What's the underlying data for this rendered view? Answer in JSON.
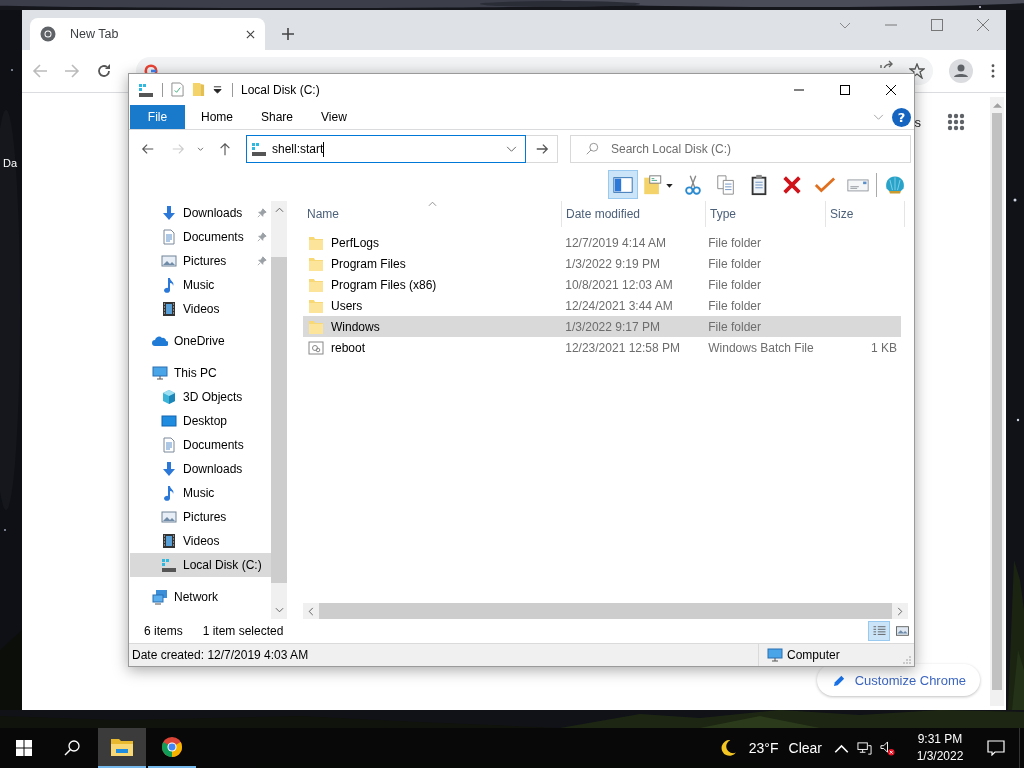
{
  "desktop": {
    "icon_label": "Da"
  },
  "browser": {
    "tab": {
      "title": "New Tab"
    },
    "link_fragment": "s",
    "customize_button": "Customize Chrome"
  },
  "explorer": {
    "title": "Local Disk (C:)",
    "ribbon_tabs": [
      {
        "label": "File",
        "kind": "file"
      },
      {
        "label": "Home",
        "kind": "tab"
      },
      {
        "label": "Share",
        "kind": "tab"
      },
      {
        "label": "View",
        "kind": "tab"
      }
    ],
    "address": {
      "value": "shell:start"
    },
    "search": {
      "placeholder": "Search Local Disk (C:)"
    },
    "help_button": "?",
    "toolbar": [
      {
        "kind": "panes",
        "on": true
      },
      {
        "kind": "new-folder",
        "on": false
      },
      {
        "kind": "cut",
        "on": false
      },
      {
        "kind": "copy",
        "on": false
      },
      {
        "kind": "paste",
        "on": false
      },
      {
        "kind": "delete",
        "on": false
      },
      {
        "kind": "check",
        "on": false
      },
      {
        "kind": "mail",
        "on": false
      },
      {
        "kind": "shell",
        "on": false
      }
    ],
    "nav_pane": [
      {
        "children": [
          {
            "label": "Downloads",
            "kind": "download",
            "pinned": true,
            "selected": false
          },
          {
            "label": "Documents",
            "kind": "document",
            "pinned": true,
            "selected": false
          },
          {
            "label": "Pictures",
            "kind": "picture",
            "pinned": true,
            "selected": false
          },
          {
            "label": "Music",
            "kind": "music",
            "pinned": false,
            "selected": false
          },
          {
            "label": "Videos",
            "kind": "video",
            "pinned": false,
            "selected": false
          }
        ]
      },
      {
        "label": "OneDrive",
        "kind": "cloud",
        "selected": false
      },
      {
        "label": "This PC",
        "kind": "pc",
        "selected": false,
        "children": [
          {
            "label": "3D Objects",
            "kind": "cube",
            "selected": false
          },
          {
            "label": "Desktop",
            "kind": "desktop",
            "selected": false
          },
          {
            "label": "Documents",
            "kind": "document",
            "selected": false
          },
          {
            "label": "Downloads",
            "kind": "download",
            "selected": false
          },
          {
            "label": "Music",
            "kind": "music",
            "selected": false
          },
          {
            "label": "Pictures",
            "kind": "picture",
            "selected": false
          },
          {
            "label": "Videos",
            "kind": "video",
            "selected": false
          },
          {
            "label": "Local Disk (C:)",
            "kind": "drive",
            "selected": true
          }
        ]
      },
      {
        "label": "Network",
        "kind": "network",
        "selected": false
      }
    ],
    "columns": [
      {
        "label": "Name",
        "sorted": true
      },
      {
        "label": "Date modified",
        "sorted": false
      },
      {
        "label": "Type",
        "sorted": false
      },
      {
        "label": "Size",
        "sorted": false
      }
    ],
    "files": [
      {
        "name": "PerfLogs",
        "date": "12/7/2019 4:14 AM",
        "type": "File folder",
        "kind": "folder",
        "selected": false
      },
      {
        "name": "Program Files",
        "date": "1/3/2022 9:19 PM",
        "type": "File folder",
        "kind": "folder",
        "selected": false
      },
      {
        "name": "Program Files (x86)",
        "date": "10/8/2021 12:03 AM",
        "type": "File folder",
        "kind": "folder",
        "selected": false
      },
      {
        "name": "Users",
        "date": "12/24/2021 3:44 AM",
        "type": "File folder",
        "kind": "folder",
        "selected": false
      },
      {
        "name": "Windows",
        "date": "1/3/2022 9:17 PM",
        "type": "File folder",
        "kind": "folder",
        "selected": true
      },
      {
        "name": "reboot",
        "date": "12/23/2021 12:58 PM",
        "type": "Windows Batch File",
        "size": "1 KB",
        "kind": "batch",
        "selected": false
      }
    ],
    "item_count": "6 items",
    "selection_info": "1 item selected",
    "view_buttons": [
      {
        "kind": "details",
        "selected": true
      },
      {
        "kind": "tiles",
        "selected": false
      }
    ],
    "status_bar": {
      "details": "Date created: 12/7/2019 4:03 AM",
      "location": "Computer"
    }
  },
  "taskbar": {
    "apps": [
      {
        "kind": "explorer",
        "active": true
      },
      {
        "kind": "chrome",
        "active": false
      }
    ],
    "weather": {
      "temperature": "23°F",
      "condition": "Clear"
    },
    "clock": {
      "time": "9:31 PM",
      "date": "1/3/2022"
    }
  }
}
